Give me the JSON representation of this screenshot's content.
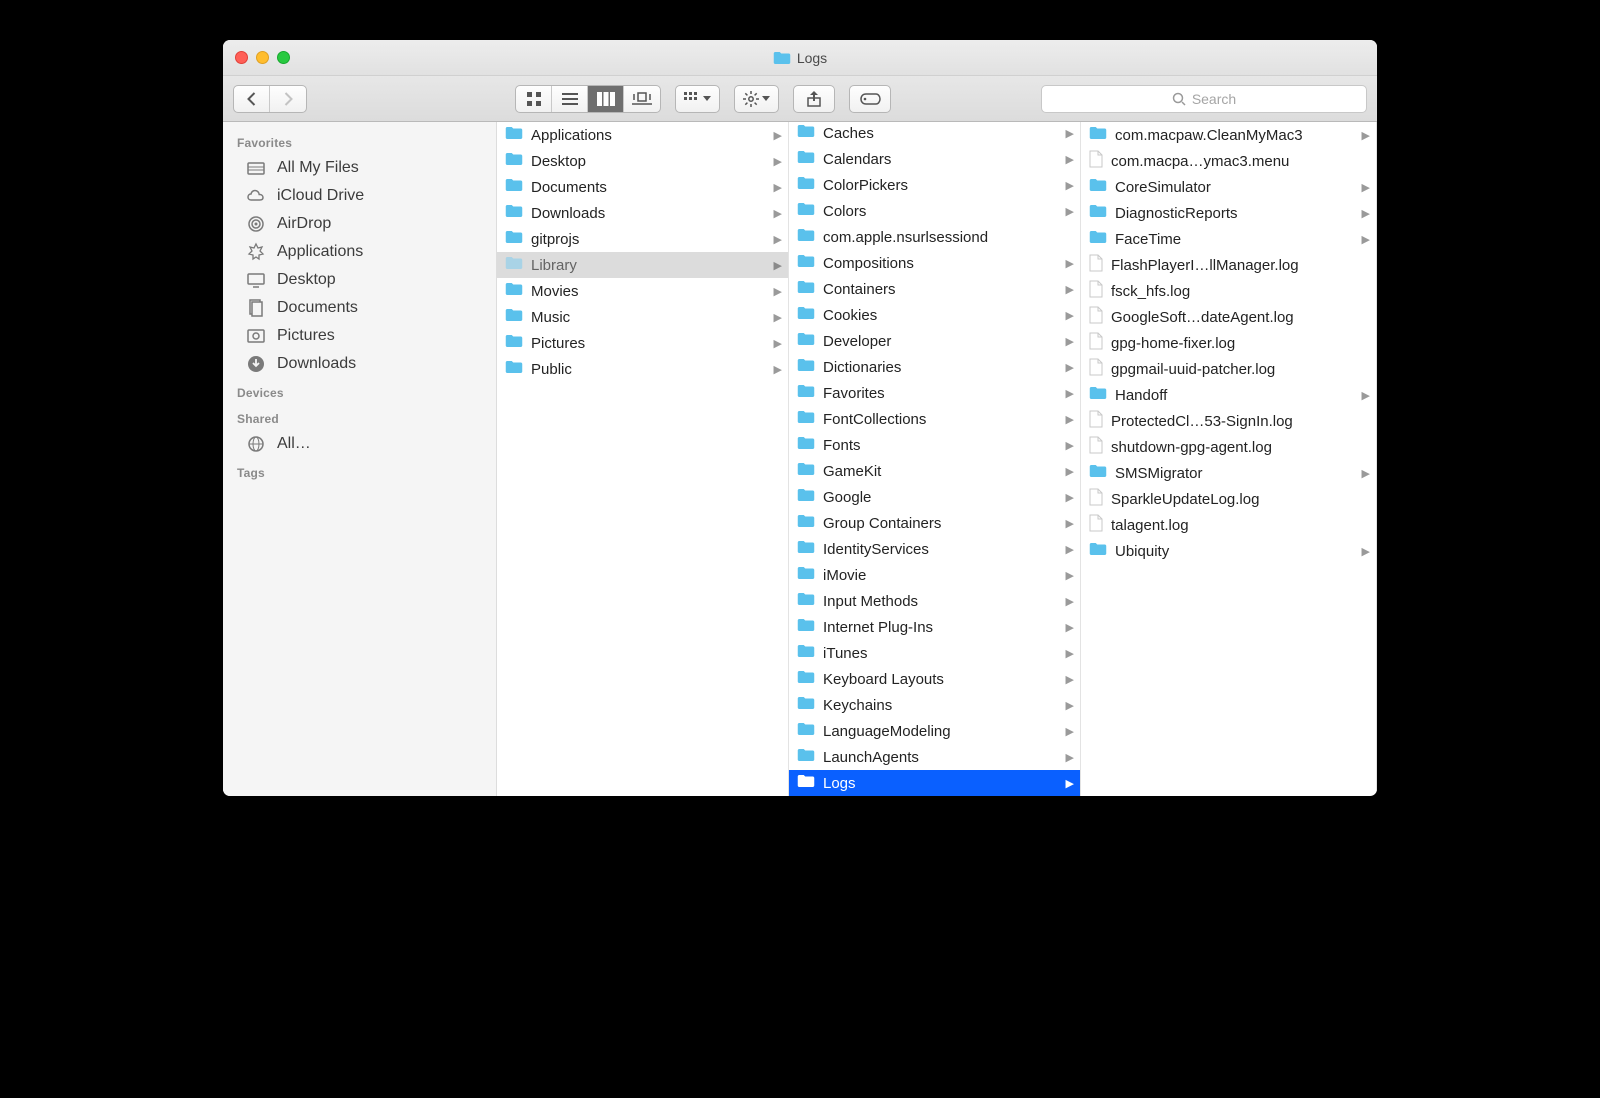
{
  "window": {
    "title": "Logs"
  },
  "toolbar": {
    "search_placeholder": "Search"
  },
  "sidebar": {
    "sections": [
      {
        "header": "Favorites",
        "items": [
          {
            "icon": "allfiles",
            "label": "All My Files"
          },
          {
            "icon": "icloud",
            "label": "iCloud Drive"
          },
          {
            "icon": "airdrop",
            "label": "AirDrop"
          },
          {
            "icon": "apps",
            "label": "Applications"
          },
          {
            "icon": "desktop",
            "label": "Desktop"
          },
          {
            "icon": "docs",
            "label": "Documents"
          },
          {
            "icon": "pictures",
            "label": "Pictures"
          },
          {
            "icon": "downloads",
            "label": "Downloads"
          }
        ]
      },
      {
        "header": "Devices",
        "items": []
      },
      {
        "header": "Shared",
        "items": [
          {
            "icon": "globe",
            "label": "All…"
          }
        ]
      },
      {
        "header": "Tags",
        "items": []
      }
    ]
  },
  "columns": [
    [
      {
        "type": "folder",
        "label": "Applications"
      },
      {
        "type": "folder",
        "label": "Desktop"
      },
      {
        "type": "folder",
        "label": "Documents"
      },
      {
        "type": "folder",
        "label": "Downloads"
      },
      {
        "type": "folder",
        "label": "gitprojs"
      },
      {
        "type": "folder",
        "label": "Library",
        "sel": "grey"
      },
      {
        "type": "folder",
        "label": "Movies"
      },
      {
        "type": "folder",
        "label": "Music"
      },
      {
        "type": "folder",
        "label": "Pictures"
      },
      {
        "type": "folder",
        "label": "Public"
      }
    ],
    [
      {
        "type": "folder",
        "label": "Caches"
      },
      {
        "type": "folder",
        "label": "Calendars"
      },
      {
        "type": "folder",
        "label": "ColorPickers"
      },
      {
        "type": "folder",
        "label": "Colors"
      },
      {
        "type": "folder",
        "label": "com.apple.nsurlsessiond",
        "noarrow": true
      },
      {
        "type": "folder",
        "label": "Compositions"
      },
      {
        "type": "folder",
        "label": "Containers"
      },
      {
        "type": "folder",
        "label": "Cookies"
      },
      {
        "type": "folder",
        "label": "Developer"
      },
      {
        "type": "folder",
        "label": "Dictionaries"
      },
      {
        "type": "folder",
        "label": "Favorites"
      },
      {
        "type": "folder",
        "label": "FontCollections"
      },
      {
        "type": "folder",
        "label": "Fonts"
      },
      {
        "type": "folder",
        "label": "GameKit"
      },
      {
        "type": "folder",
        "label": "Google"
      },
      {
        "type": "folder",
        "label": "Group Containers"
      },
      {
        "type": "folder",
        "label": "IdentityServices"
      },
      {
        "type": "folder",
        "label": "iMovie"
      },
      {
        "type": "folder",
        "label": "Input Methods"
      },
      {
        "type": "folder",
        "label": "Internet Plug-Ins"
      },
      {
        "type": "folder",
        "label": "iTunes"
      },
      {
        "type": "folder",
        "label": "Keyboard Layouts"
      },
      {
        "type": "folder",
        "label": "Keychains"
      },
      {
        "type": "folder",
        "label": "LanguageModeling"
      },
      {
        "type": "folder",
        "label": "LaunchAgents"
      },
      {
        "type": "folder",
        "label": "Logs",
        "sel": "blue"
      }
    ],
    [
      {
        "type": "folder",
        "label": "com.macpaw.CleanMyMac3"
      },
      {
        "type": "file",
        "label": "com.macpa…ymac3.menu"
      },
      {
        "type": "folder",
        "label": "CoreSimulator"
      },
      {
        "type": "folder",
        "label": "DiagnosticReports"
      },
      {
        "type": "folder",
        "label": "FaceTime"
      },
      {
        "type": "file",
        "label": "FlashPlayerI…llManager.log"
      },
      {
        "type": "file",
        "label": "fsck_hfs.log"
      },
      {
        "type": "file",
        "label": "GoogleSoft…dateAgent.log"
      },
      {
        "type": "file",
        "label": "gpg-home-fixer.log"
      },
      {
        "type": "file",
        "label": "gpgmail-uuid-patcher.log"
      },
      {
        "type": "folder",
        "label": "Handoff"
      },
      {
        "type": "file",
        "label": "ProtectedCl…53-SignIn.log"
      },
      {
        "type": "file",
        "label": "shutdown-gpg-agent.log"
      },
      {
        "type": "folder",
        "label": "SMSMigrator"
      },
      {
        "type": "file",
        "label": "SparkleUpdateLog.log"
      },
      {
        "type": "file",
        "label": "talagent.log"
      },
      {
        "type": "folder",
        "label": "Ubiquity"
      }
    ]
  ]
}
